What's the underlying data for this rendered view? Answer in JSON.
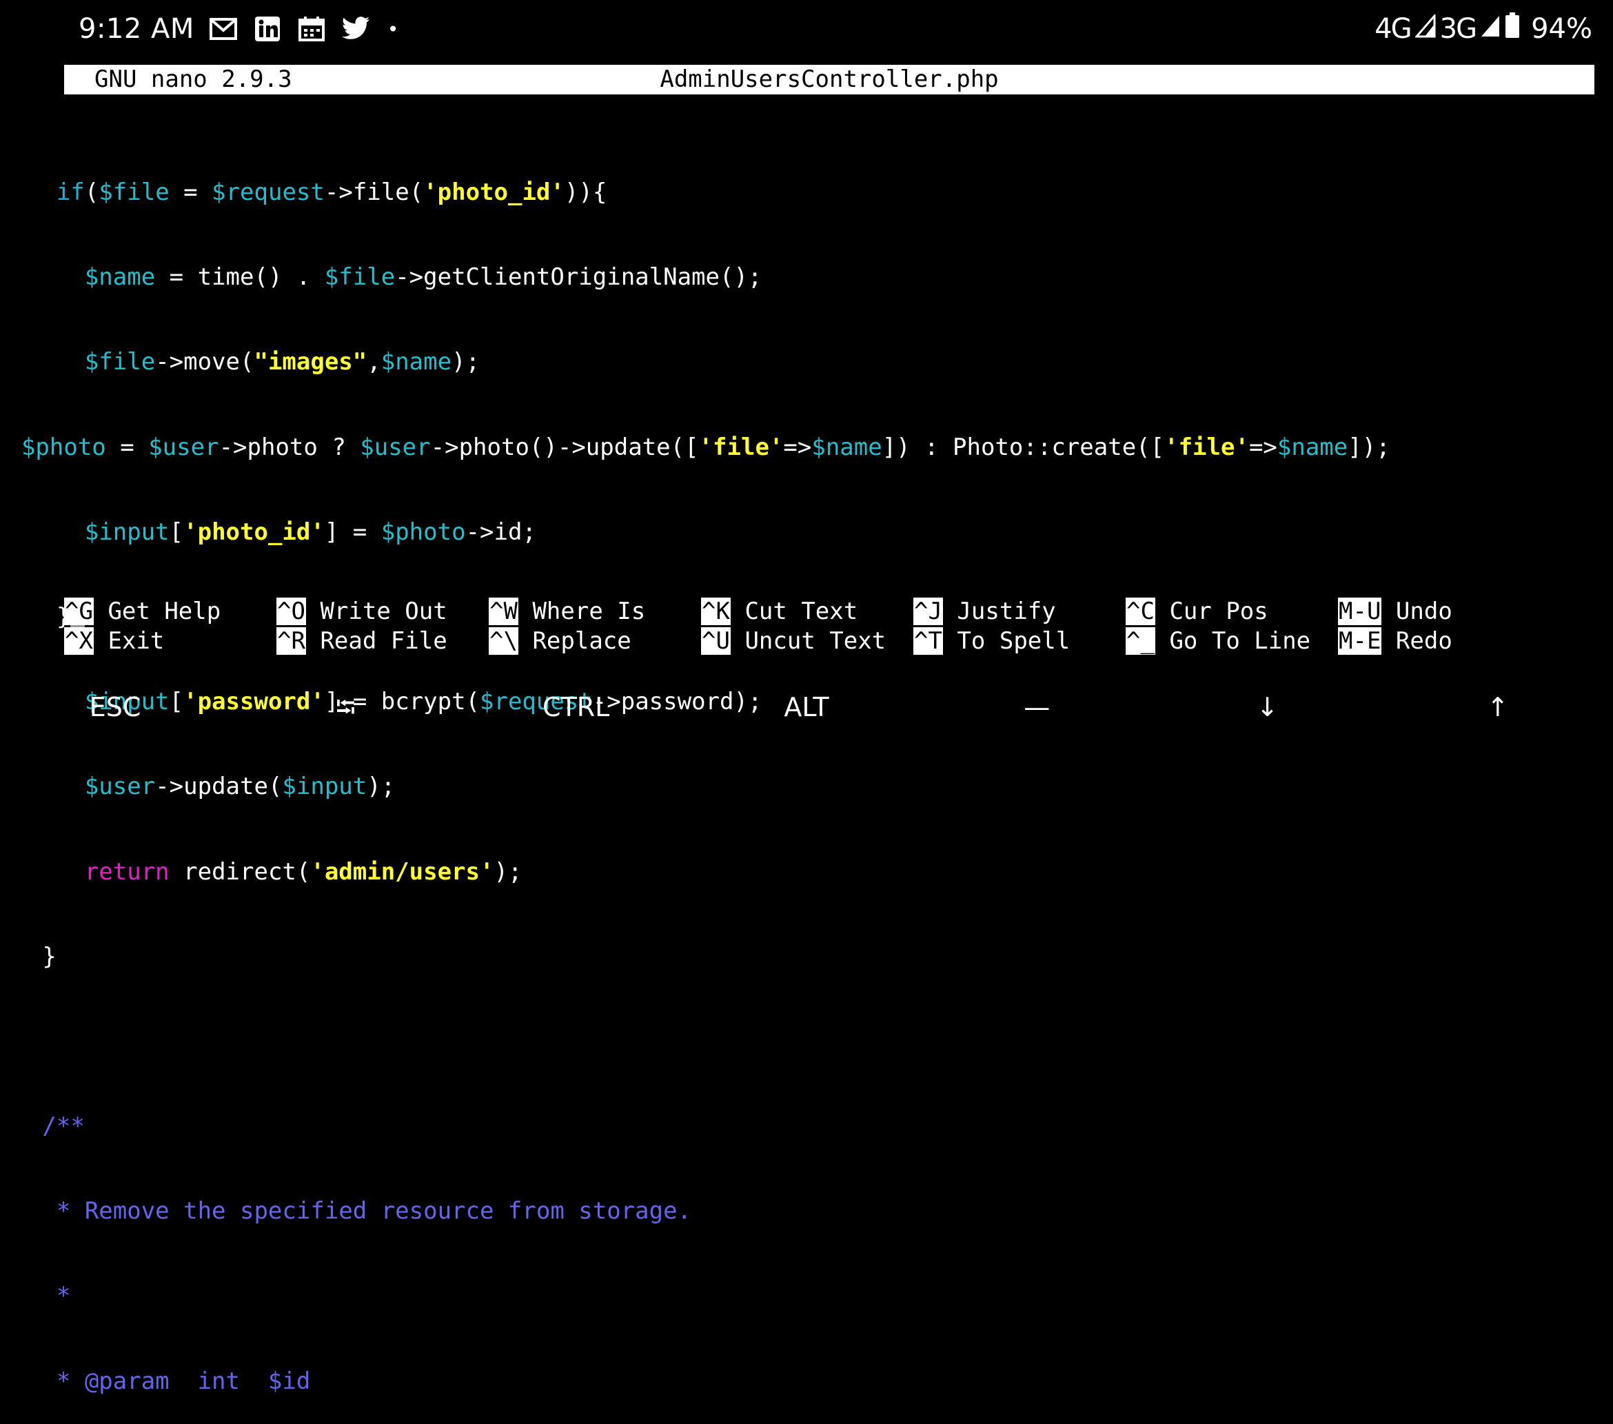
{
  "status_bar": {
    "time": "9:12 AM",
    "icons": [
      "gmail-icon",
      "linkedin-icon",
      "calendar-icon",
      "twitter-icon"
    ],
    "dot": "•",
    "network1": "4G",
    "network2": "3G",
    "battery": "94%"
  },
  "nano": {
    "version": "GNU nano 2.9.3",
    "filename": "AdminUsersController.php"
  },
  "code": {
    "l1": {
      "indent": "    ",
      "kw": "if",
      "p1": "(",
      "v1": "$file",
      "p2": " = ",
      "v2": "$request",
      "p3": "->file(",
      "s1": "'photo_id'",
      "p4": ")){"
    },
    "l2": {
      "indent": "      ",
      "v1": "$name",
      "p1": " = time() . ",
      "v2": "$file",
      "p2": "->getClientOriginalName();"
    },
    "l3": {
      "indent": "      ",
      "v1": "$file",
      "p1": "->move(",
      "s1": "\"images\"",
      "p2": ",",
      "v2": "$name",
      "p3": ");"
    },
    "l4": {
      "indent": "  ",
      "v1": "$photo",
      "p1": " = ",
      "v2": "$user",
      "p2": "->photo ? ",
      "v3": "$user",
      "p3": "->photo()->update([",
      "s1": "'file'",
      "p4": "=>",
      "v4": "$name",
      "p5": "]) : Photo::create([",
      "s2": "'file'",
      "p6": "=>",
      "v5": "$name",
      "p7": "]);"
    },
    "l5": {
      "indent": "      ",
      "v1": "$input",
      "p1": "[",
      "s1": "'photo_id'",
      "p2": "] = ",
      "v2": "$photo",
      "p3": "->id;"
    },
    "l6": {
      "indent": "    ",
      "p1": "}"
    },
    "l7": {
      "indent": "      ",
      "v1": "$input",
      "p1": "[",
      "s1": "'password'",
      "p2": "] = bcrypt(",
      "v2": "$request",
      "p3": "->password);"
    },
    "l8": {
      "indent": "      ",
      "v1": "$user",
      "p1": "->update(",
      "v2": "$input",
      "p2": ");"
    },
    "l9": {
      "indent": "      ",
      "kw": "return",
      "p1": " redirect(",
      "s1": "'admin/users'",
      "p2": ");"
    },
    "l10": {
      "indent": "   ",
      "p1": "}"
    },
    "l12": {
      "indent": "   ",
      "c": "/**"
    },
    "l13": {
      "indent": "    ",
      "c": "* Remove the specified resource from storage."
    },
    "l14": {
      "indent": "    ",
      "c": "*"
    },
    "l15": {
      "indent": "    ",
      "c": "* @param  int  $id"
    }
  },
  "shortcuts": {
    "row1": [
      {
        "key": "^G",
        "label": "Get Help"
      },
      {
        "key": "^O",
        "label": "Write Out"
      },
      {
        "key": "^W",
        "label": "Where Is"
      },
      {
        "key": "^K",
        "label": "Cut Text"
      },
      {
        "key": "^J",
        "label": "Justify"
      },
      {
        "key": "^C",
        "label": "Cur Pos"
      },
      {
        "key": "M-U",
        "label": "Undo"
      }
    ],
    "row2": [
      {
        "key": "^X",
        "label": "Exit"
      },
      {
        "key": "^R",
        "label": "Read File"
      },
      {
        "key": "^\\",
        "label": "Replace"
      },
      {
        "key": "^U",
        "label": "Uncut Text"
      },
      {
        "key": "^T",
        "label": "To Spell"
      },
      {
        "key": "^_",
        "label": "Go To Line"
      },
      {
        "key": "M-E",
        "label": "Redo"
      }
    ]
  },
  "extra_keys": {
    "esc": "ESC",
    "tab": "⭾",
    "ctrl": "CTRL",
    "alt": "ALT",
    "dash": "—",
    "down": "↓",
    "up": "↑"
  }
}
